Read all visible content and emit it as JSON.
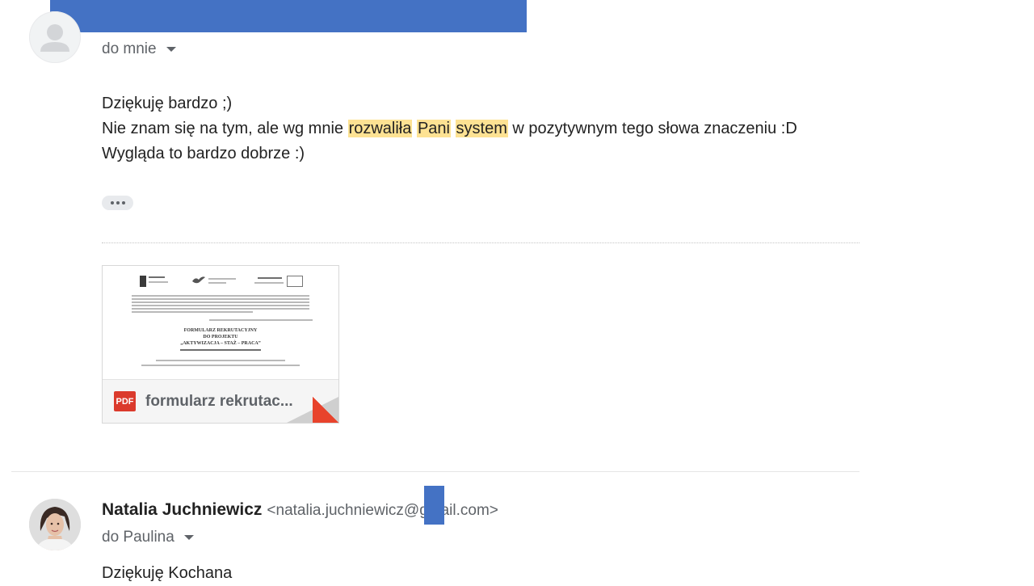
{
  "message1": {
    "recipient_label": "do mnie",
    "body_line1": "Dziękuję bardzo  ;)",
    "body_line2_prefix": "Nie znam się na tym, ale wg mnie ",
    "body_line2_hl1": "rozwaliła",
    "body_line2_hl2": "Pani",
    "body_line2_hl3": "system",
    "body_line2_suffix": " w pozytywnym tego słowa znaczeniu :D",
    "body_line3": "Wygląda to bardzo dobrze :)",
    "attachment": {
      "type_badge": "PDF",
      "name": "formularz rekrutac...",
      "preview_line1": "FORMULARZ REKRUTACYJNY",
      "preview_line2": "DO PROJEKTU",
      "preview_line3": "„AKTYWIZACJA – STAŻ – PRACA”"
    }
  },
  "message2": {
    "sender_name": "Natalia Juchniewicz",
    "sender_email": "<natalia.juchniewicz@gmail.com>",
    "recipient_label": "do Paulina",
    "body_line1": "Dziękuję Kochana"
  },
  "colors": {
    "highlight": "#fde293",
    "redaction": "#4472c4",
    "pdf_red": "#db3a2c"
  }
}
